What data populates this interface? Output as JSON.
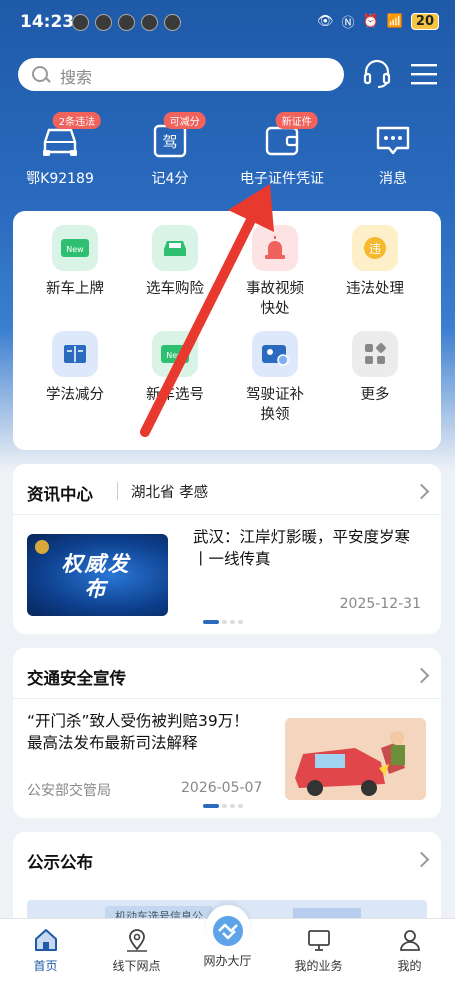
{
  "status": {
    "time": "14:23",
    "battery": "20"
  },
  "search": {
    "placeholder": "搜索"
  },
  "quick": [
    {
      "label": "鄂K92189",
      "badge": "2条违法"
    },
    {
      "label": "记4分",
      "badge": "可减分"
    },
    {
      "label": "电子证件凭证",
      "badge": "新证件"
    },
    {
      "label": "消息",
      "badge": ""
    }
  ],
  "services": [
    {
      "label": "新车上牌"
    },
    {
      "label": "选车购险"
    },
    {
      "label": "事故视频快处"
    },
    {
      "label": "违法处理"
    },
    {
      "label": "学法减分"
    },
    {
      "label": "新车选号"
    },
    {
      "label": "驾驶证补换领"
    },
    {
      "label": "更多"
    }
  ],
  "news": {
    "title": "资讯中心",
    "region": "湖北省 孝感",
    "image_text": "权威发布",
    "headline": "武汉：江岸灯影暖，平安度岁寒丨一线传真",
    "date": "2025-12-31"
  },
  "safety": {
    "title": "交通安全宣传",
    "headline": "“开门杀”致人受伤被判赔39万！最高法发布最新司法解释",
    "source": "公安部交管局",
    "date": "2026-05-07"
  },
  "notice": {
    "title": "公示公布",
    "preview": "机动车选号信息公"
  },
  "tabs": [
    {
      "label": "首页"
    },
    {
      "label": "线下网点"
    },
    {
      "label": "网办大厅"
    },
    {
      "label": "我的业务"
    },
    {
      "label": "我的"
    }
  ],
  "colors": {
    "primary": "#1e5aa8",
    "badge": "#f0625c",
    "arrow": "#e8392f"
  }
}
